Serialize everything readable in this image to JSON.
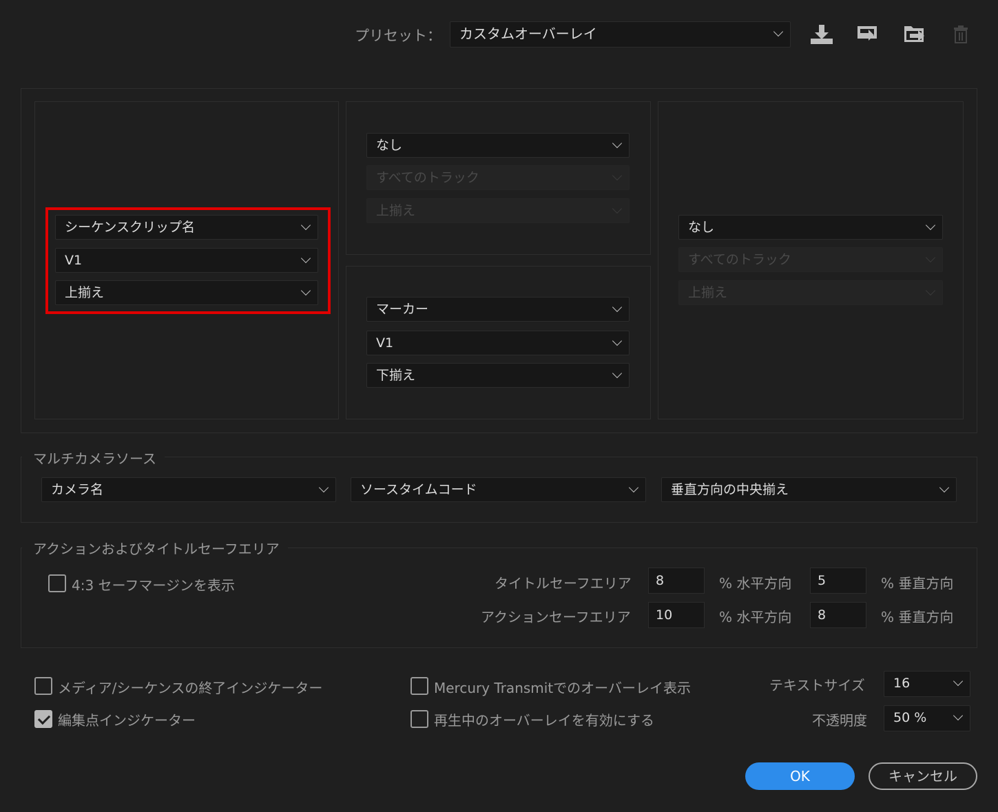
{
  "header": {
    "preset_label": "プリセット：",
    "preset_value": "カスタムオーバーレイ",
    "icons": [
      "import-icon",
      "save-preset-icon",
      "export-preset-icon",
      "delete-icon"
    ]
  },
  "overlay_grid": {
    "left": {
      "source": "シーケンスクリップ名",
      "track": "V1",
      "align": "上揃え"
    },
    "center_top": {
      "source": "なし",
      "track": "すべてのトラック",
      "align": "上揃え"
    },
    "center_bottom": {
      "source": "マーカー",
      "track": "V1",
      "align": "下揃え"
    },
    "right": {
      "source": "なし",
      "track": "すべてのトラック",
      "align": "上揃え"
    },
    "highlight_color": "#e00000"
  },
  "multicam": {
    "title": "マルチカメラソース",
    "camera": "カメラ名",
    "timecode": "ソースタイムコード",
    "align": "垂直方向の中央揃え"
  },
  "safe_area": {
    "title": "アクションおよびタイトルセーフエリア",
    "show_43_label": "4:3 セーフマージンを表示",
    "title_safe_label": "タイトルセーフエリア",
    "title_h": "8",
    "title_v": "5",
    "action_safe_label": "アクションセーフエリア",
    "action_h": "10",
    "action_v": "8",
    "pct_h": "% 水平方向",
    "pct_v": "% 垂直方向"
  },
  "options": {
    "media_end_label": "メディア/シーケンスの終了インジケーター",
    "edit_point_label": "編集点インジケーター",
    "mercury_label": "Mercury Transmitでのオーバーレイ表示",
    "playback_label": "再生中のオーバーレイを有効にする",
    "text_size_label": "テキストサイズ",
    "text_size_value": "16",
    "opacity_label": "不透明度",
    "opacity_value": "50 %"
  },
  "buttons": {
    "ok": "OK",
    "cancel": "キャンセル",
    "accent": "#2d8ceb"
  }
}
